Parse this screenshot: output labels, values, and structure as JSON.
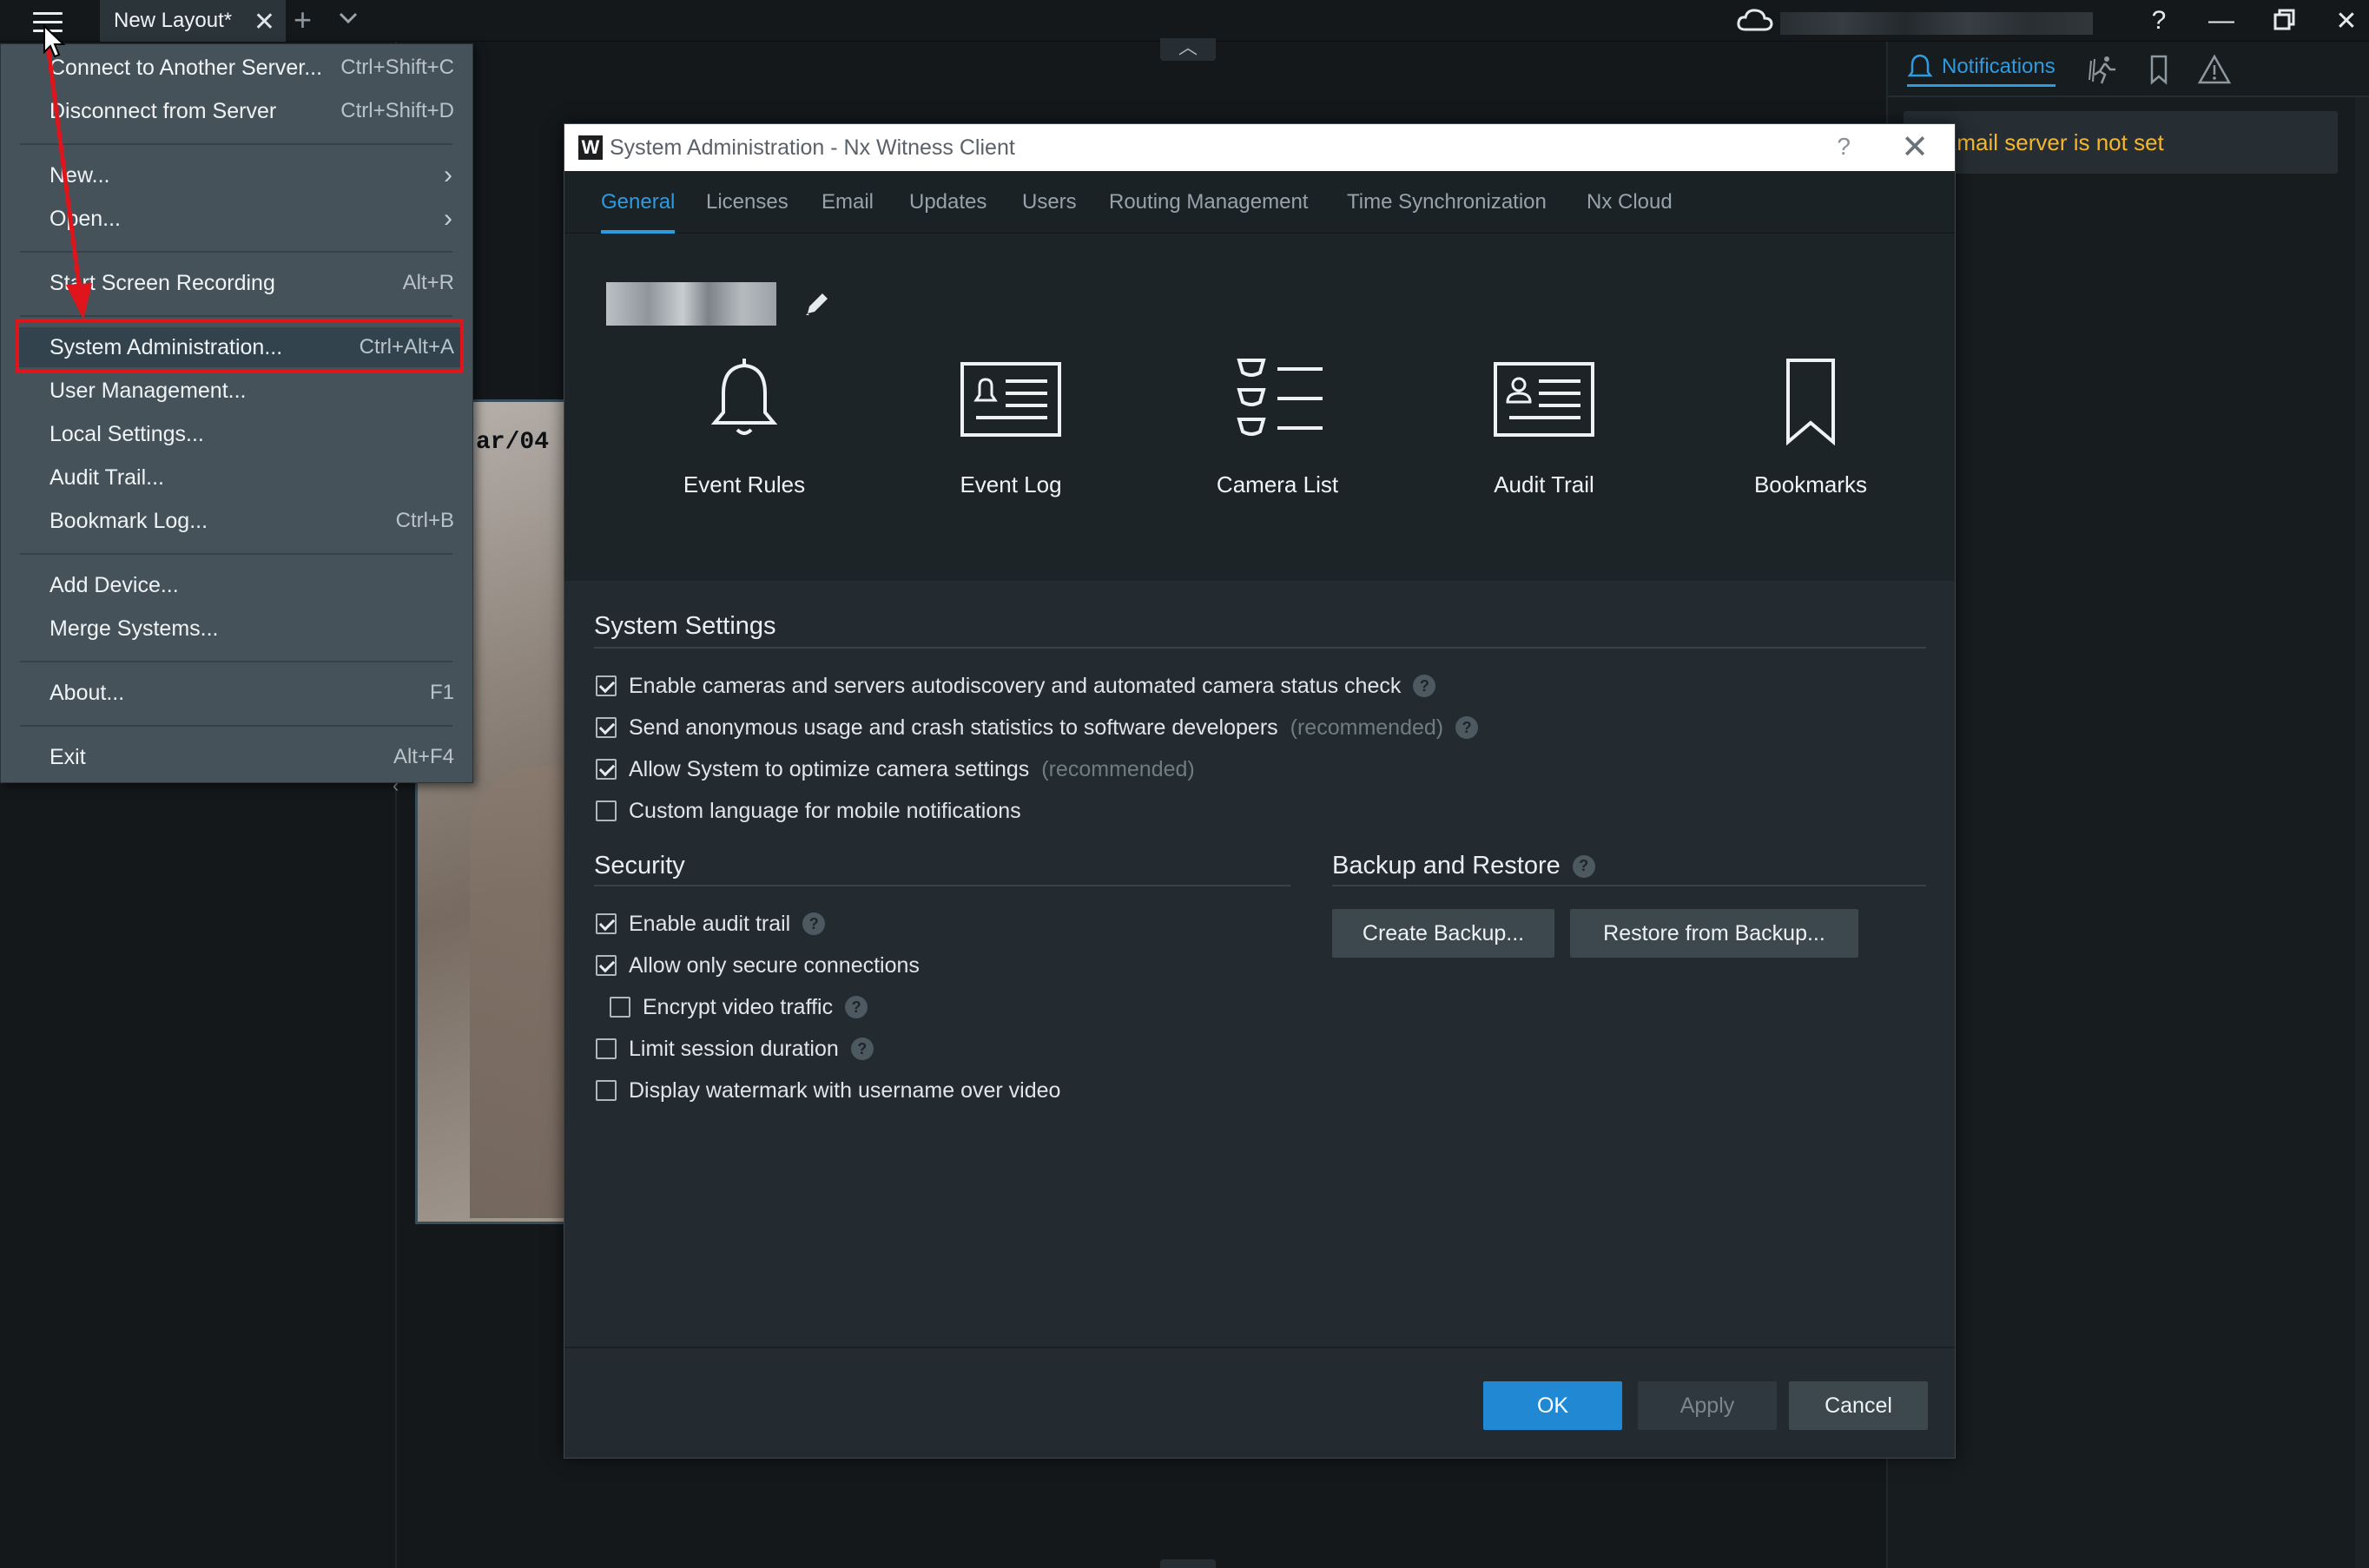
{
  "titlebar": {
    "tab_label": "New Layout*",
    "tab_close": "✕",
    "add_tab": "+",
    "help": "?",
    "minimize": "—",
    "close": "✕"
  },
  "background": {
    "camera_label": "ar/04"
  },
  "right_panel": {
    "notifications_label": "Notifications",
    "email_warning": "Email server is not set"
  },
  "menu": {
    "items": [
      {
        "label": "Connect to Another Server...",
        "shortcut": "Ctrl+Shift+C"
      },
      {
        "label": "Disconnect from Server",
        "shortcut": "Ctrl+Shift+D"
      },
      {
        "label": "New...",
        "shortcut": "›"
      },
      {
        "label": "Open...",
        "shortcut": "›"
      },
      {
        "label": "Start Screen Recording",
        "shortcut": "Alt+R"
      },
      {
        "label": "System Administration...",
        "shortcut": "Ctrl+Alt+A"
      },
      {
        "label": "User Management...",
        "shortcut": ""
      },
      {
        "label": "Local Settings...",
        "shortcut": ""
      },
      {
        "label": "Audit Trail...",
        "shortcut": ""
      },
      {
        "label": "Bookmark Log...",
        "shortcut": "Ctrl+B"
      },
      {
        "label": "Add Device...",
        "shortcut": ""
      },
      {
        "label": "Merge Systems...",
        "shortcut": ""
      },
      {
        "label": "About...",
        "shortcut": "F1"
      },
      {
        "label": "Exit",
        "shortcut": "Alt+F4"
      }
    ]
  },
  "dialog": {
    "title": "System Administration - Nx Witness Client",
    "logo": "W",
    "help": "?",
    "close": "✕",
    "tabs": [
      "General",
      "Licenses",
      "Email",
      "Updates",
      "Users",
      "Routing Management",
      "Time Synchronization",
      "Nx Cloud"
    ],
    "active_tab": "General",
    "tiles": [
      "Event Rules",
      "Event Log",
      "Camera List",
      "Audit Trail",
      "Bookmarks"
    ],
    "system_settings": {
      "title": "System Settings",
      "options": [
        {
          "label": "Enable cameras and servers autodiscovery and automated camera status check",
          "note": "",
          "checked": true,
          "help": true
        },
        {
          "label": "Send anonymous usage and crash statistics to software developers",
          "note": "(recommended)",
          "checked": true,
          "help": true
        },
        {
          "label": "Allow System to optimize camera settings",
          "note": "(recommended)",
          "checked": true,
          "help": false
        },
        {
          "label": "Custom language for mobile notifications",
          "note": "",
          "checked": false,
          "help": false
        }
      ]
    },
    "security": {
      "title": "Security",
      "options": [
        {
          "label": "Enable audit trail",
          "checked": true,
          "help": true
        },
        {
          "label": "Allow only secure connections",
          "checked": true,
          "help": false
        },
        {
          "label": "Encrypt video traffic",
          "checked": false,
          "help": true
        },
        {
          "label": "Limit session duration",
          "checked": false,
          "help": true
        },
        {
          "label": "Display watermark with username over video",
          "checked": false,
          "help": false
        }
      ]
    },
    "backup": {
      "title": "Backup and Restore",
      "create_label": "Create Backup...",
      "restore_label": "Restore from Backup..."
    },
    "footer": {
      "ok": "OK",
      "apply": "Apply",
      "cancel": "Cancel"
    },
    "help_glyph": "?"
  },
  "colors": {
    "accent": "#2e9be0",
    "warning": "#f5b62c",
    "highlight_box": "#e0141b"
  }
}
